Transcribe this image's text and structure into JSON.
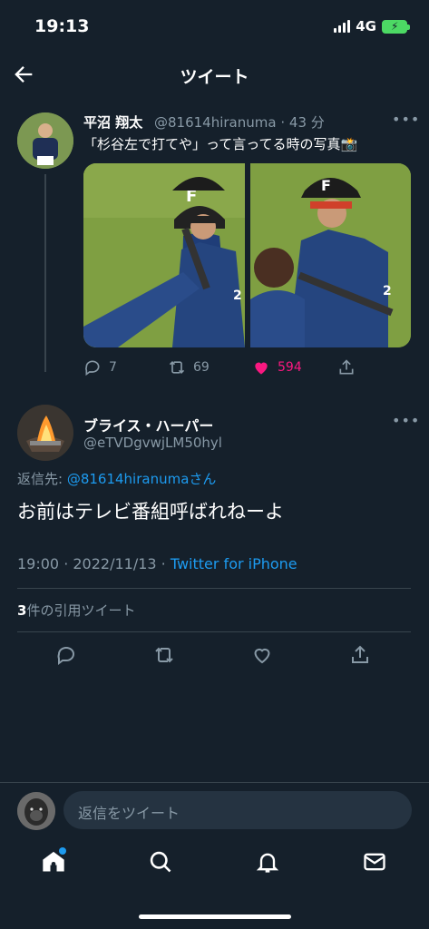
{
  "status": {
    "time": "19:13",
    "network": "4G"
  },
  "header": {
    "title": "ツイート"
  },
  "tweet1": {
    "name": "平沼 翔太",
    "handle": "@81614hiranuma",
    "time": "· 43 分",
    "text": "「杉谷左で打てや」って言ってる時の写真📸",
    "replies": "7",
    "retweets": "69",
    "likes": "594"
  },
  "tweet2": {
    "name": "ブライス・ハーパー",
    "handle": "@eTVDgvwjLM50hyl",
    "reply_prefix": "返信先: ",
    "reply_mention": "@81614hiranuma",
    "reply_suffix": "さん",
    "body": "お前はテレビ番組呼ばれねーよ",
    "timestamp": "19:00 · 2022/11/13 · ",
    "client": "Twitter for iPhone",
    "quote_count": "3",
    "quote_label": "件の引用ツイート"
  },
  "reply_bar": {
    "placeholder": "返信をツイート"
  },
  "icons": {
    "back": "arrow-left-icon",
    "reply": "speech-bubble-icon",
    "retweet": "retweet-icon",
    "like": "heart-icon",
    "share": "share-icon",
    "home": "home-icon",
    "search": "search-icon",
    "notifications": "bell-icon",
    "messages": "mail-icon"
  },
  "colors": {
    "background": "#15202b",
    "accent": "#1d9bf0",
    "like": "#f91880",
    "muted": "#8899a6"
  }
}
